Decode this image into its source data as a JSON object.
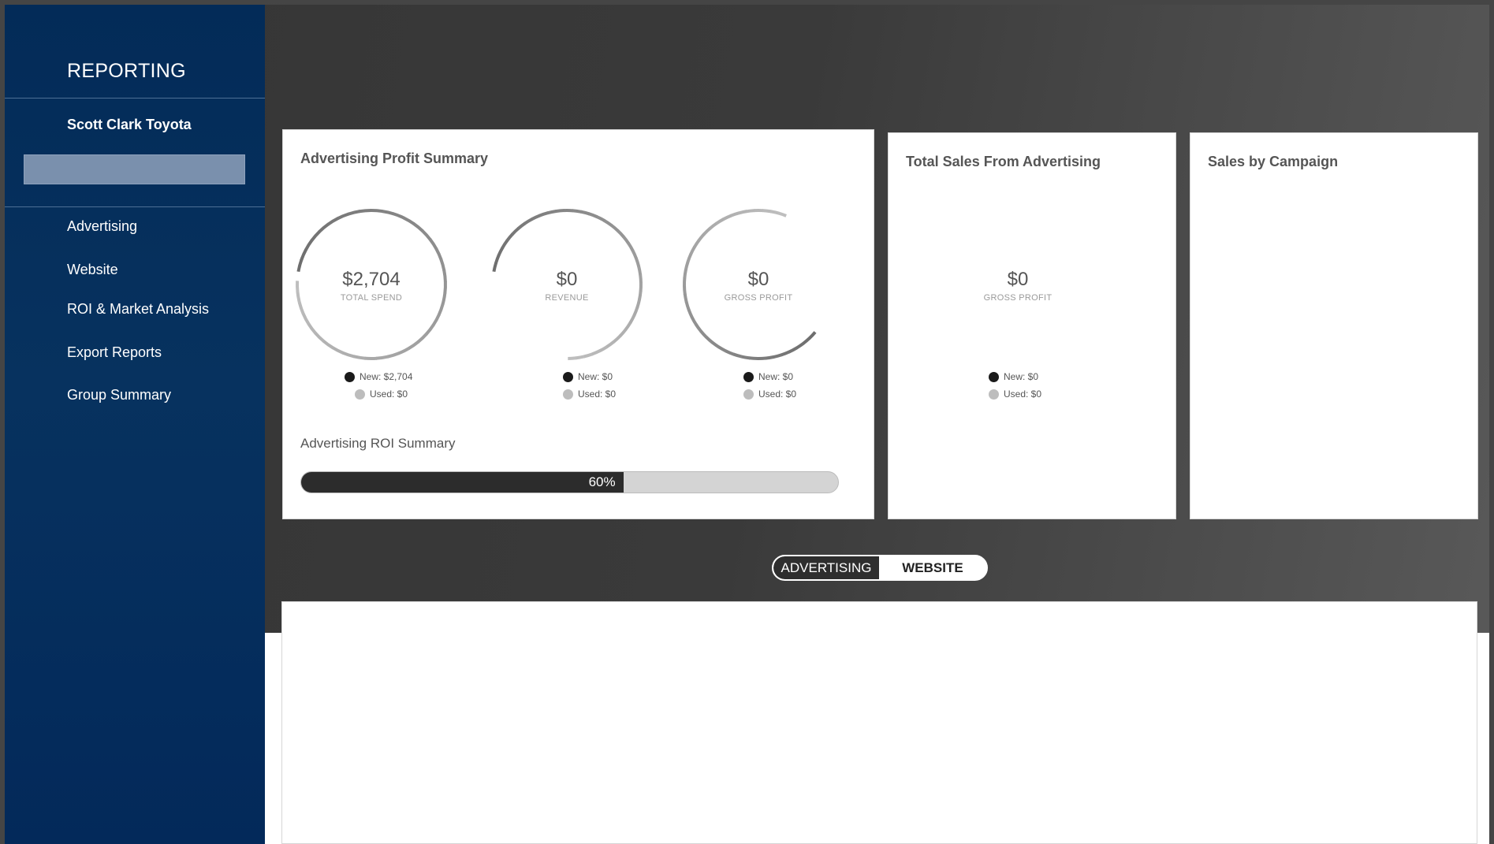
{
  "sidebar": {
    "title": "REPORTING",
    "dealer_name": "Scott Clark Toyota",
    "nav": [
      {
        "label": "Advertising"
      },
      {
        "label": "Website"
      },
      {
        "label": "ROI & Market Analysis"
      },
      {
        "label": "Export Reports"
      },
      {
        "label": "Group Summary"
      }
    ]
  },
  "profit_summary": {
    "title": "Advertising Profit Summary",
    "gauges": [
      {
        "value": "$2,704",
        "label": "TOTAL SPEND",
        "new": "New: $2,704",
        "used": "Used: $0",
        "fill": 0.98
      },
      {
        "value": "$0",
        "label": "REVENUE",
        "new": "New: $0",
        "used": "Used: $0",
        "fill": 0.72
      },
      {
        "value": "$0",
        "label": "GROSS PROFIT",
        "new": "New: $0",
        "used": "Used: $0",
        "fill": 0.7
      }
    ],
    "roi_title": "Advertising ROI Summary",
    "roi_text": "60%",
    "roi_fraction": 0.6
  },
  "total_sales": {
    "title": "Total Sales From Advertising",
    "value": "$0",
    "label": "GROSS PROFIT",
    "new": "New: $0",
    "used": "Used: $0"
  },
  "sales_by_campaign": {
    "title": "Sales by Campaign"
  },
  "toggle": {
    "left_label": "ADVERTISING",
    "right_label": "WEBSITE"
  },
  "colors": {
    "sidebar_bg": "#032b58",
    "gauge_ring": "#777777",
    "roi_fill": "#2c2c2c"
  }
}
